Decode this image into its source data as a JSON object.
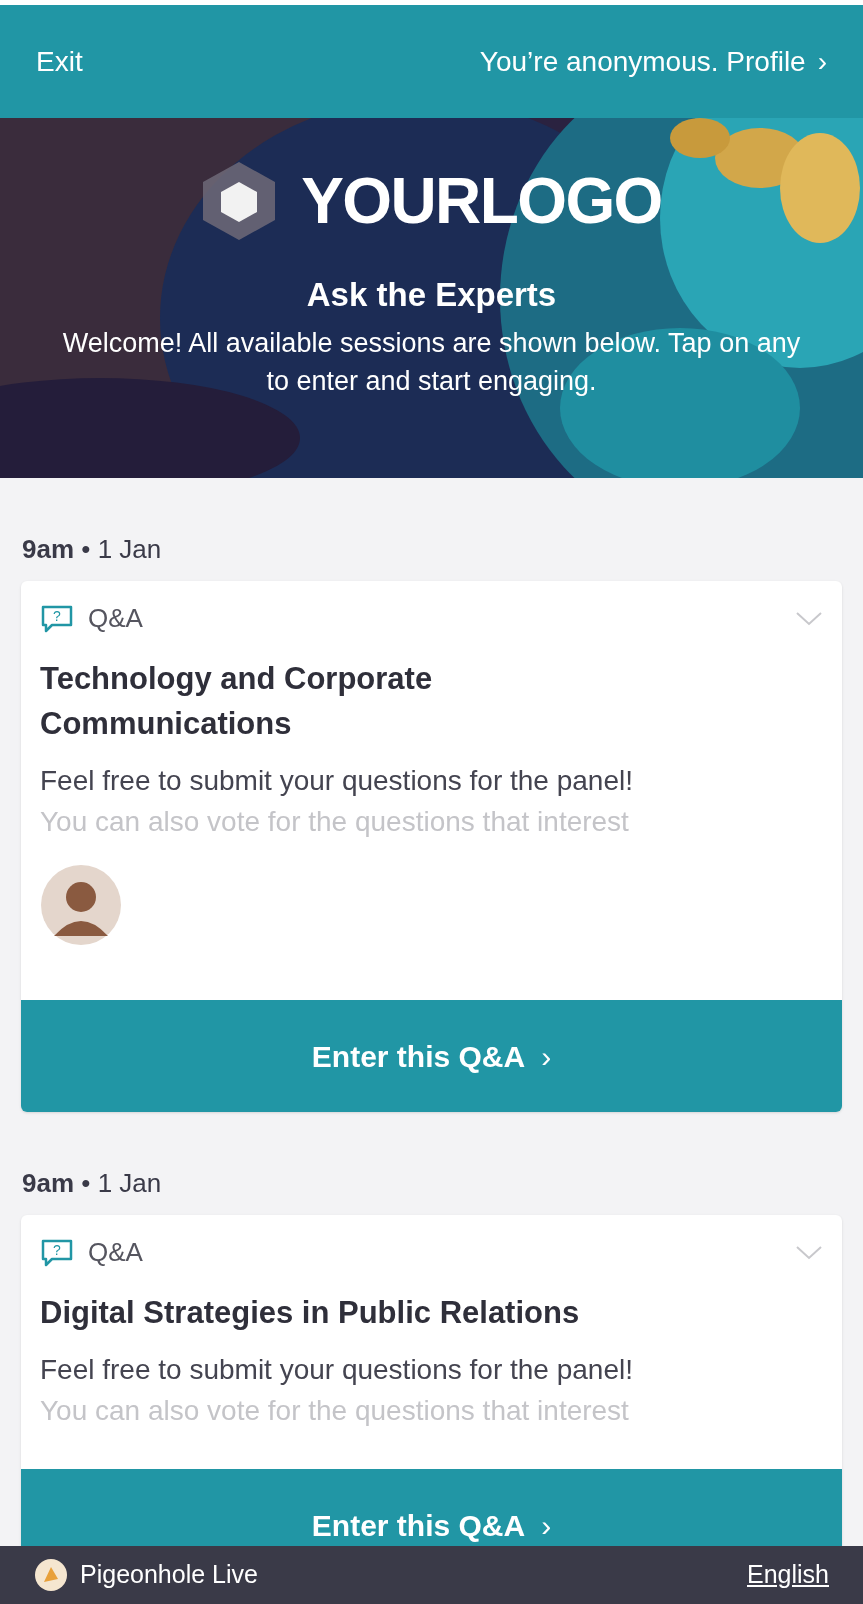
{
  "header": {
    "exit": "Exit",
    "profile": "You’re anonymous. Profile",
    "profile_chevron": "›"
  },
  "banner": {
    "kind": "picture",
    "logo": "YOURLOGO",
    "title": "Ask the Experts",
    "welcome": "Welcome! All available sessions are shown below. Tap on any to enter and start engaging."
  },
  "sessions": [
    {
      "time": "9am",
      "separator": "•",
      "date": "1 Jan",
      "type_icon": "?",
      "type": "Q&A",
      "title": "Technology and Corporate Communications",
      "description": "Feel free to submit your questions for the panel!",
      "description_faded": "You can also vote for the questions that interest",
      "has_avatar": true,
      "button": "Enter this Q&A",
      "chevron": "›"
    },
    {
      "time": "9am",
      "separator": "•",
      "date": "1 Jan",
      "type_icon": "?",
      "type": "Q&A",
      "title": "Digital Strategies in Public Relations",
      "description": "Feel free to submit your questions for the panel!",
      "description_faded": "You can also vote for the questions that interest",
      "has_avatar": false,
      "button": "Enter this Q&A",
      "chevron": "›"
    }
  ],
  "footer": {
    "brand": "Pigeonhole Live",
    "language": "English"
  }
}
